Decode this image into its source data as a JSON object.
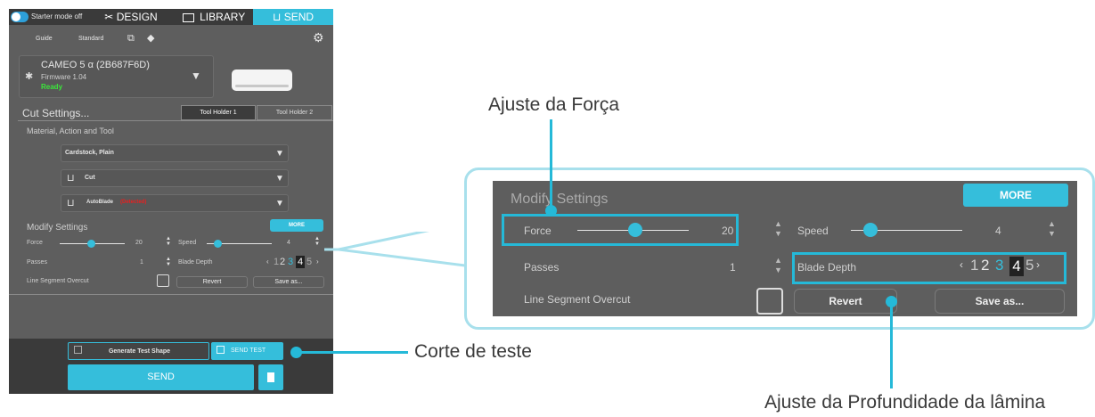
{
  "app": {
    "starter_mode": "Starter mode off",
    "tabs": [
      "DESIGN",
      "LIBRARY",
      "SEND"
    ],
    "subtabs": [
      "Guide",
      "Standard"
    ],
    "device": {
      "name": "CAMEO 5 α (2B687F6D)",
      "firmware": "Firmware 1.04",
      "status": "Ready"
    },
    "cut_settings": "Cut Settings...",
    "tool_holders": [
      "Tool Holder 1",
      "Tool Holder 2"
    ],
    "material_header": "Material, Action and Tool",
    "material": "Cardstock, Plain",
    "action": "Cut",
    "tool": "AutoBlade",
    "tool_status": "(Detected)",
    "modify_settings": "Modify Settings",
    "more": "MORE",
    "force_label": "Force",
    "force_value": "20",
    "speed_label": "Speed",
    "speed_value": "4",
    "passes_label": "Passes",
    "passes_value": "1",
    "blade_depth_label": "Blade Depth",
    "line_overcut_label": "Line Segment Overcut",
    "revert": "Revert",
    "save_as": "Save as...",
    "generate_test_shape": "Generate Test Shape",
    "send_test": "SEND TEST",
    "send": "SEND"
  },
  "zoom": {
    "modify_settings": "Modify Settings",
    "more": "MORE",
    "force_label": "Force",
    "force_value": "20",
    "speed_label": "Speed",
    "speed_value": "4",
    "passes_label": "Passes",
    "passes_value": "1",
    "blade_depth_label": "Blade Depth",
    "line_overcut_label": "Line Segment Overcut",
    "revert": "Revert",
    "save_as": "Save as..."
  },
  "blade_digits": [
    "1",
    "2",
    "3",
    "4",
    "5"
  ],
  "callouts": {
    "force": "Ajuste da Força",
    "test_cut": "Corte de teste",
    "blade_depth": "Ajuste da Profundidade da lâmina"
  },
  "colors": {
    "accent": "#35bedb",
    "panel": "#5e5e5e",
    "ready": "#3be63b",
    "detected": "#e82020"
  }
}
